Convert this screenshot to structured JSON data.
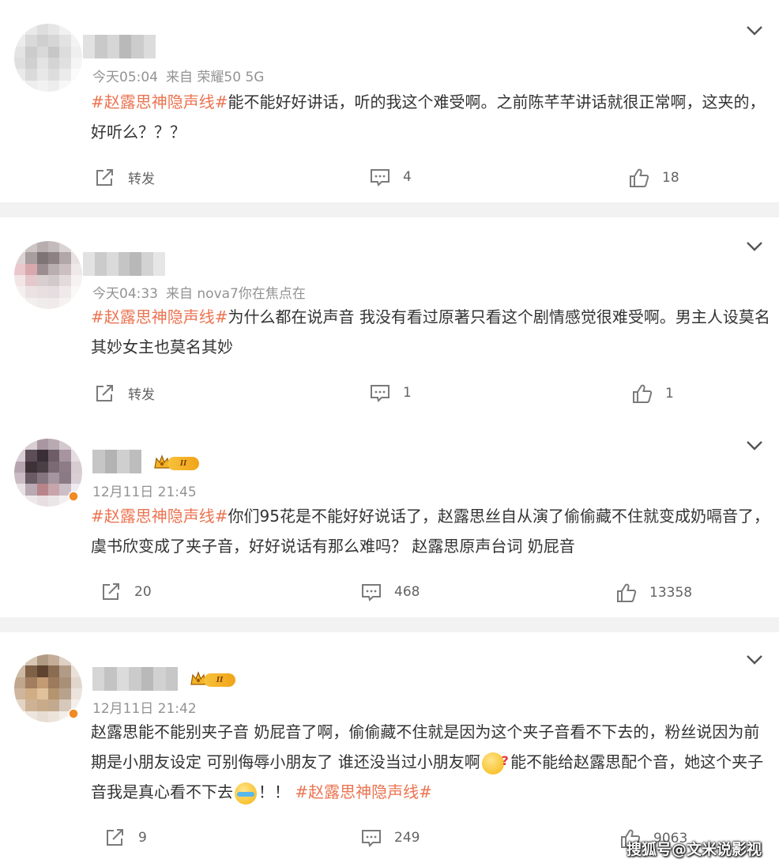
{
  "icons": {
    "repost": "repost-icon",
    "comment": "comment-icon",
    "like": "like-icon",
    "expand": "chevron-down-icon"
  },
  "colors": {
    "hashtag": "#eb7350",
    "meta": "#939393",
    "separator": "#f2f2f2",
    "vip_gold": "#f1a318"
  },
  "posts": [
    {
      "time": "今天05:04",
      "source": "来自 荣耀50 5G",
      "text_parts": [
        {
          "tag": "#赵露思神隐声线#"
        },
        {
          "plain": "能不能好好讲话，听的我这个难受啊。之前陈芊芊讲话就很正常啊，这夹的，好听么？？？"
        }
      ],
      "repost_label": "转发",
      "comment_count": "4",
      "like_count": "18"
    },
    {
      "time": "今天04:33",
      "source": "来自 nova7你在焦点在",
      "text_parts": [
        {
          "tag": "#赵露思神隐声线#"
        },
        {
          "plain": "为什么都在说声音 我没有看过原著只看这个剧情感觉很难受啊。男主人设莫名其妙女主也莫名其妙"
        }
      ],
      "repost_label": "转发",
      "comment_count": "1",
      "like_count": "1"
    },
    {
      "time": "12月11日 21:45",
      "source": "",
      "vip_level": "II",
      "text_parts": [
        {
          "tag": "#赵露思神隐声线#"
        },
        {
          "plain": "你们95花是不能好好说话了，赵露思丝自从演了偷偷藏不住就变成奶嗝音了，虞书欣变成了夹子音，好好说话有那么难吗？ 赵露思原声台词 奶屁音"
        }
      ],
      "repost_count": "20",
      "comment_count": "468",
      "like_count": "13358"
    },
    {
      "time": "12月11日 21:42",
      "source": "",
      "vip_level": "II",
      "text_a": "赵露思能不能别夹子音 奶屁音了啊，偷偷藏不住就是因为这个夹子音看不下去的，粉丝说因为前期是小朋友设定 可别侮辱小朋友了 谁还没当过小朋友啊",
      "text_b": " 能不能给赵露思配个音，她这个夹子音我是真心看不下去",
      "text_c": "！！ ",
      "text_tag": "#赵露思神隐声线#",
      "emoji_a": "thinking-emoji",
      "emoji_b": "crying-emoji",
      "repost_count": "9",
      "comment_count": "249",
      "like_count": "9063"
    }
  ],
  "watermark": "搜狐号@文米说影视"
}
